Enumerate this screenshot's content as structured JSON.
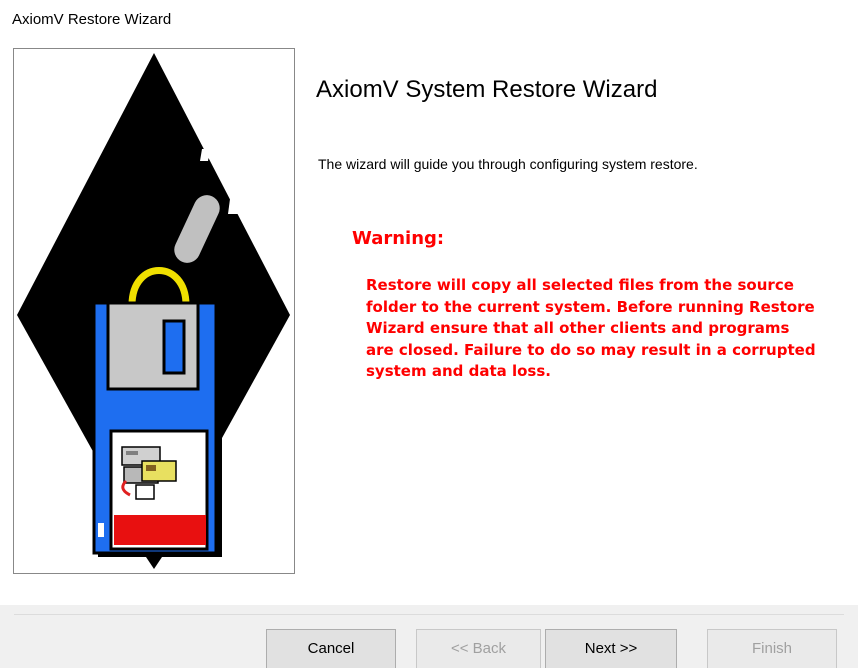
{
  "window": {
    "title": "AxiomV Restore Wizard"
  },
  "page": {
    "heading": "AxiomV System Restore Wizard",
    "intro": "The wizard will guide you through configuring system restore.",
    "warning_title": "Warning:",
    "warning_text": "Restore will copy all selected files from the source folder to the current system. Before running Restore Wizard ensure that all other clients and programs are closed. Failure to do so may result in a corrupted system and data loss."
  },
  "buttons": {
    "cancel": "Cancel",
    "back": "<< Back",
    "next": "Next >>",
    "finish": "Finish"
  },
  "colors": {
    "warning": "#ff0000",
    "floppy": "#1e6ef0",
    "floppy_label": "#e81010",
    "handle": "#f0e000"
  },
  "icons": {
    "illustration": "floppy-disk-restore-illustration",
    "computer": "computer-restore-icon"
  }
}
